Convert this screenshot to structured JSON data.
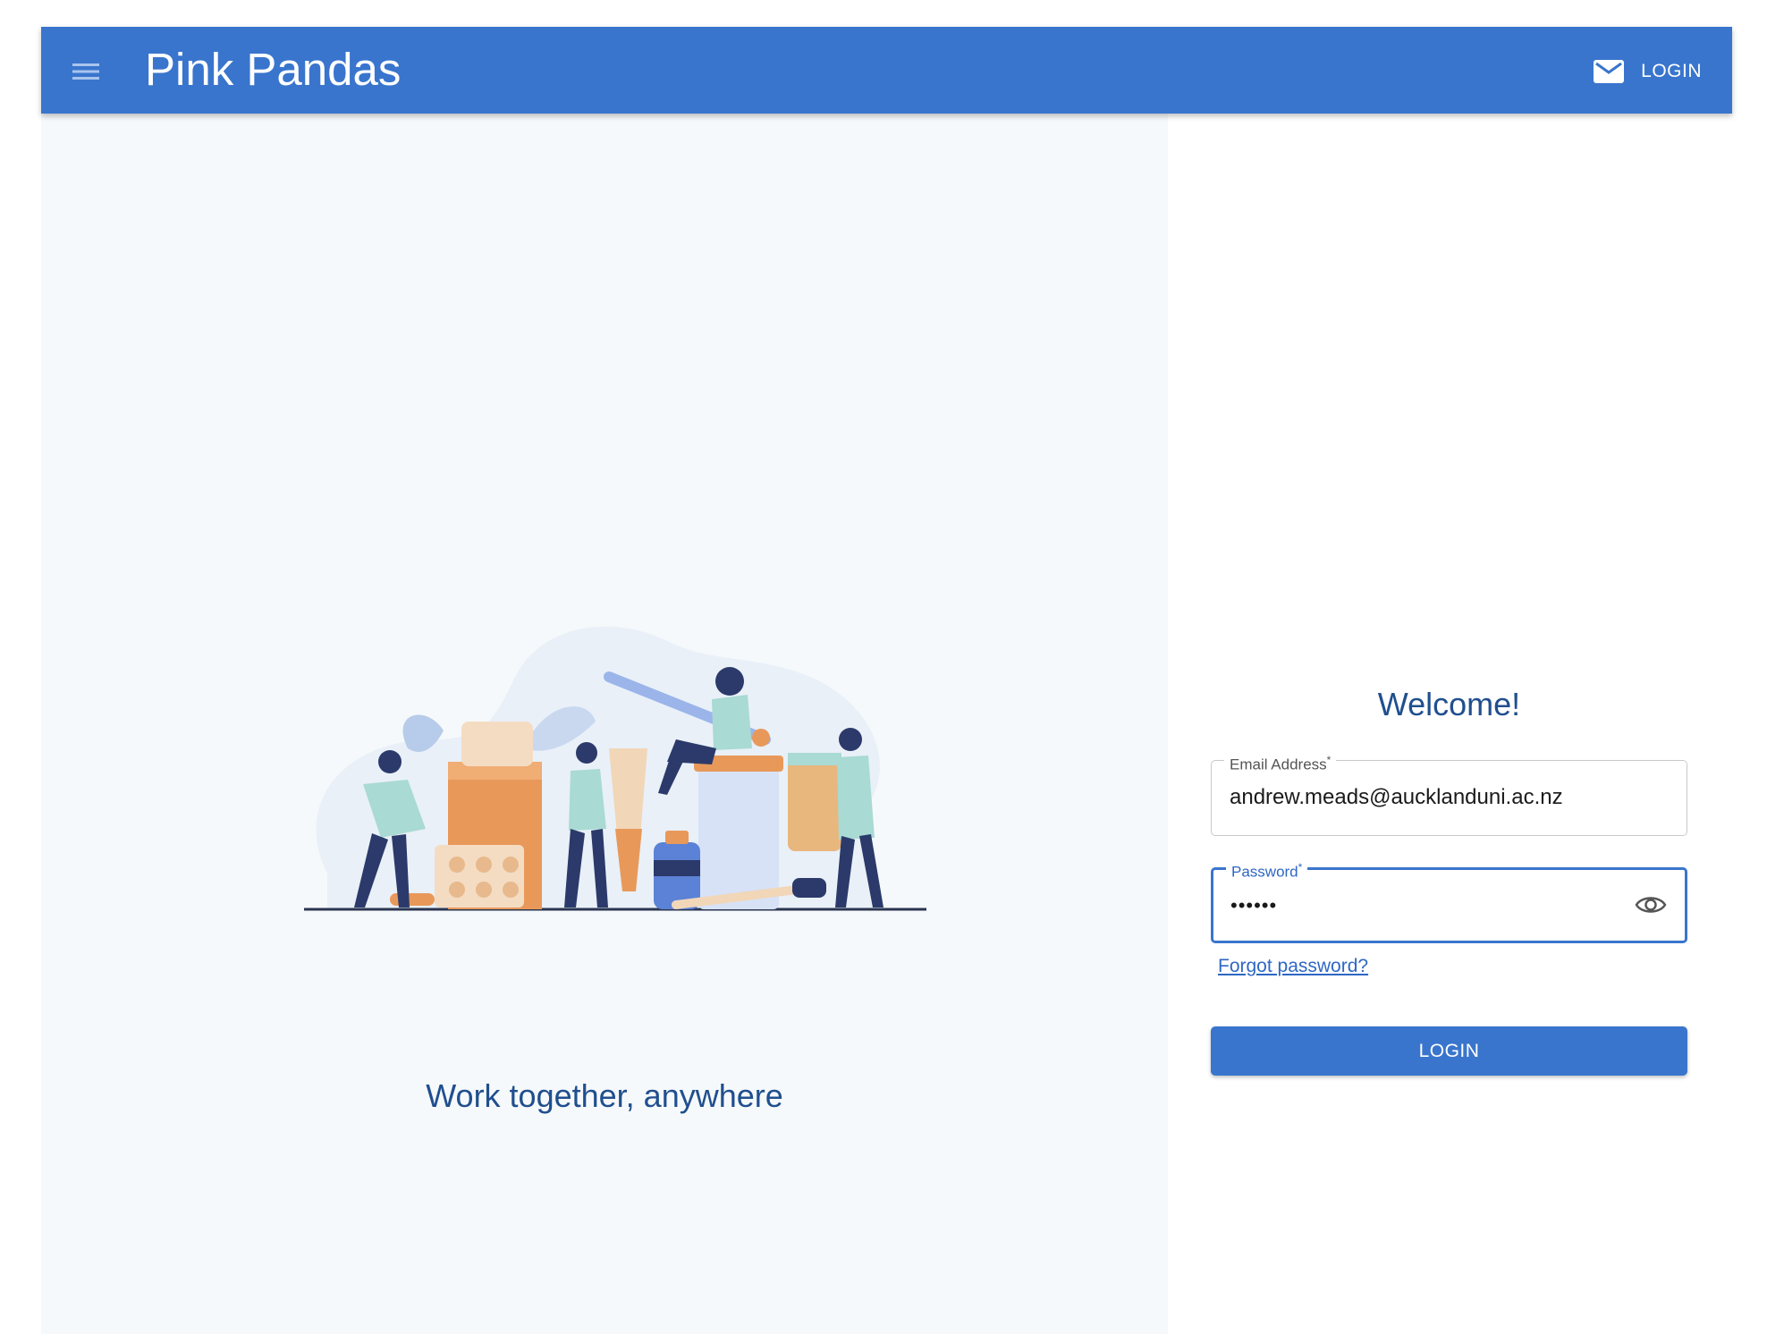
{
  "appbar": {
    "title": "Pink Pandas",
    "login_label": "LOGIN",
    "color": "#3975cd",
    "menu_icon": "hamburger-menu-icon",
    "mail_icon": "mail-icon"
  },
  "hero": {
    "tagline": "Work together, anywhere",
    "illustration": "people-with-medicine-illustration"
  },
  "login": {
    "welcome": "Welcome!",
    "email": {
      "label": "Email Address",
      "required_mark": "*",
      "value": "andrew.meads@aucklanduni.ac.nz"
    },
    "password": {
      "label": "Password",
      "required_mark": "*",
      "value": "••••••",
      "visibility_icon": "eye-icon"
    },
    "forgot_link": "Forgot password?",
    "submit_label": "LOGIN"
  }
}
